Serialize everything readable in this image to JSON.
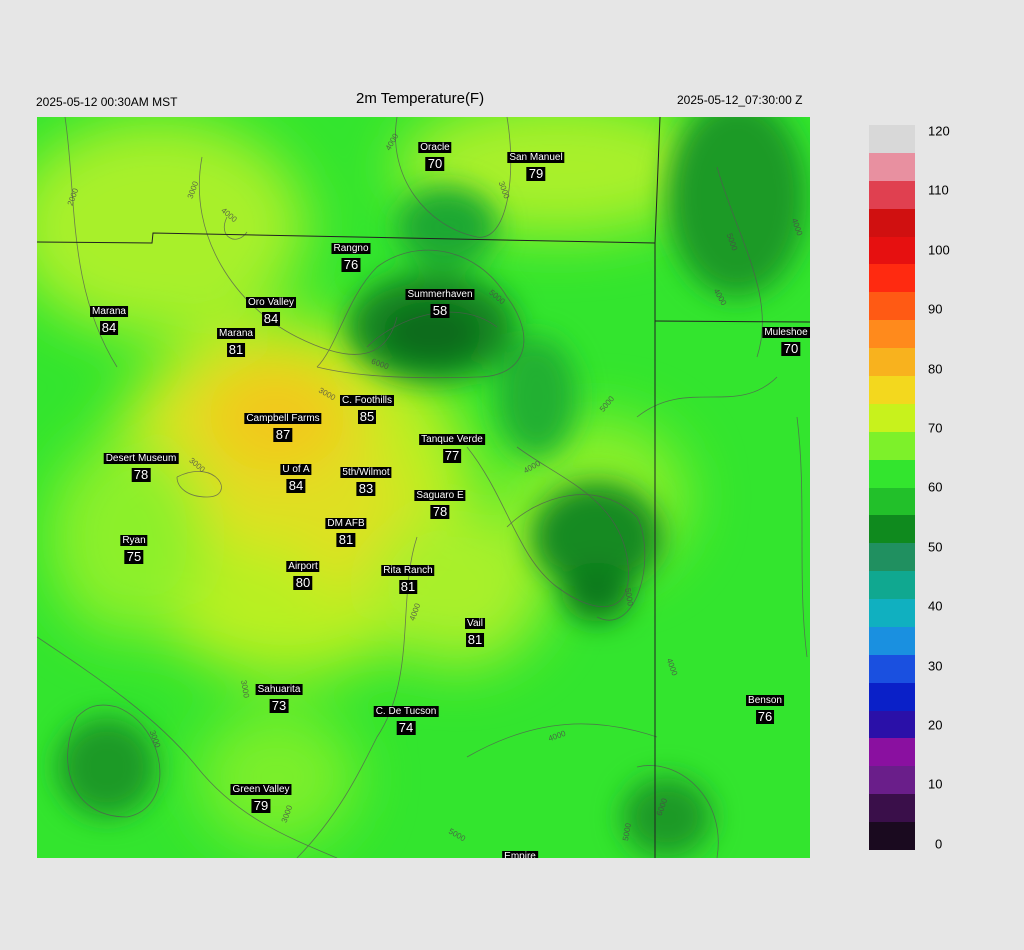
{
  "header": {
    "title": "2m Temperature(F)",
    "valid_local": "2025-05-12 00:30AM MST",
    "valid_utc": "2025-05-12_07:30:00 Z"
  },
  "colors": {
    "background": "#e6e6e6",
    "field_base": "#33e52e",
    "warm_core": "#f0d81e",
    "cool_terrain": "#0f7a1e"
  },
  "stations": [
    {
      "name": "Oracle",
      "value": "70"
    },
    {
      "name": "San Manuel",
      "value": "79"
    },
    {
      "name": "Rangno",
      "value": "76"
    },
    {
      "name": "Summerhaven",
      "value": "58"
    },
    {
      "name": "Marana",
      "value": "84"
    },
    {
      "name": "Oro Valley",
      "value": "84"
    },
    {
      "name": "Marana",
      "value": "81"
    },
    {
      "name": "Muleshoe R",
      "value": "70"
    },
    {
      "name": "C. Foothills",
      "value": "85"
    },
    {
      "name": "Campbell Farms",
      "value": "87"
    },
    {
      "name": "Tanque Verde",
      "value": "77"
    },
    {
      "name": "Desert Museum",
      "value": "78"
    },
    {
      "name": "U of A",
      "value": "84"
    },
    {
      "name": "5th/Wilmot",
      "value": "83"
    },
    {
      "name": "Saguaro E",
      "value": "78"
    },
    {
      "name": "DM AFB",
      "value": "81"
    },
    {
      "name": "Ryan",
      "value": "75"
    },
    {
      "name": "Airport",
      "value": "80"
    },
    {
      "name": "Rita Ranch",
      "value": "81"
    },
    {
      "name": "Vail",
      "value": "81"
    },
    {
      "name": "Sahuarita",
      "value": "73"
    },
    {
      "name": "C. De Tucson",
      "value": "74"
    },
    {
      "name": "Benson",
      "value": "76"
    },
    {
      "name": "Green Valley",
      "value": "79"
    },
    {
      "name": "Empire",
      "value": ""
    }
  ],
  "contour_labels": [
    "2000",
    "3000",
    "4000",
    "4000",
    "3000",
    "5000",
    "6000",
    "3000",
    "3000",
    "5000",
    "4000",
    "4000",
    "5000",
    "4000",
    "4000",
    "3000",
    "3000",
    "4000",
    "5000",
    "4000",
    "5000",
    "3000",
    "5000",
    "6000"
  ],
  "colorbar": {
    "labels": [
      "120",
      "110",
      "100",
      "90",
      "80",
      "70",
      "60",
      "50",
      "40",
      "30",
      "20",
      "10",
      "0"
    ],
    "colors": [
      "#1a0a1f",
      "#3a0f4a",
      "#6a1e8a",
      "#8a10a0",
      "#2a10a8",
      "#0a20c8",
      "#1a50e0",
      "#1a90e0",
      "#10b0c0",
      "#10a890",
      "#209060",
      "#0f8a1e",
      "#22c02a",
      "#33e52e",
      "#7df12a",
      "#c8f21c",
      "#f3d81e",
      "#f8b21e",
      "#ff8a1c",
      "#ff5a14",
      "#ff2a10",
      "#e61010",
      "#d01010",
      "#e04050",
      "#e890a0",
      "#d8d8d8"
    ]
  }
}
